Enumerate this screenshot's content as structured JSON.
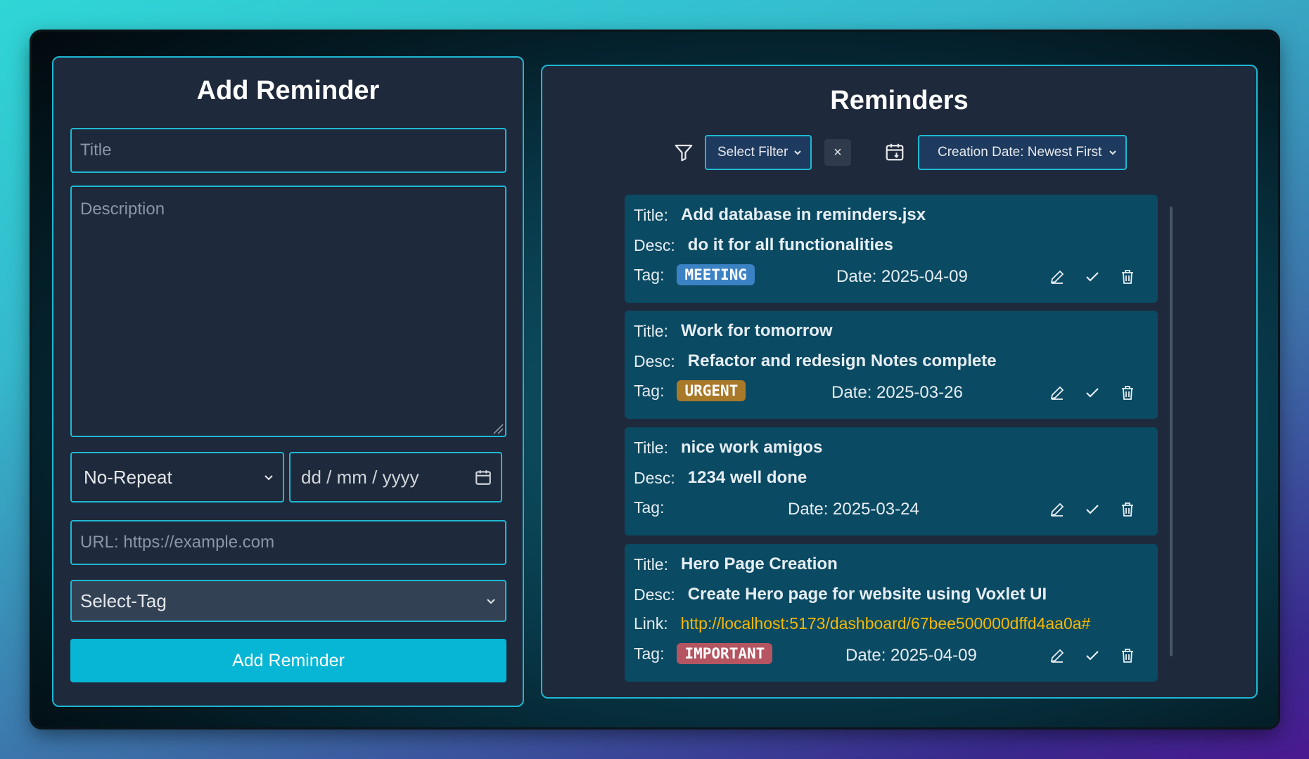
{
  "add_form": {
    "heading": "Add Reminder",
    "title_placeholder": "Title",
    "description_placeholder": "Description",
    "repeat_selected": "No-Repeat",
    "date_placeholder": "dd / mm / yyyy",
    "url_placeholder": "URL: https://example.com",
    "tag_selected": "Select-Tag",
    "submit_label": "Add Reminder"
  },
  "reminders": {
    "heading": "Reminders",
    "filter_selected": "Select Filter",
    "clear_label": "×",
    "sort_selected": "Creation Date: Newest First",
    "labels": {
      "title": "Title:",
      "desc": "Desc:",
      "tag": "Tag:",
      "link": "Link:"
    },
    "items": [
      {
        "title": "Add database in reminders.jsx",
        "desc": "do it for all functionalities",
        "tag": "MEETING",
        "tag_color": "#3b82c4",
        "date": "Date: 2025-04-09"
      },
      {
        "title": "Work for tomorrow",
        "desc": "Refactor and redesign Notes complete",
        "tag": "URGENT",
        "tag_color": "#a9792a",
        "date": "Date: 2025-03-26"
      },
      {
        "title": "nice work amigos",
        "desc": "1234 well done",
        "tag": "",
        "date": "Date: 2025-03-24"
      },
      {
        "title": "Hero Page Creation",
        "desc": "Create Hero page for website using Voxlet UI",
        "link": "http://localhost:5173/dashboard/67bee500000dffd4aa0a#",
        "tag": "IMPORTANT",
        "tag_color": "#b45561",
        "date": "Date: 2025-04-09"
      }
    ]
  },
  "icons": [
    "filter-icon",
    "calendar-sort-icon",
    "calendar-icon",
    "chevron-down-icon",
    "edit-icon",
    "check-icon",
    "trash-icon"
  ],
  "colors": {
    "accent": "#06b6d4",
    "panel": "#1e293b",
    "card": "#0b4a63",
    "link": "#f5b800"
  }
}
